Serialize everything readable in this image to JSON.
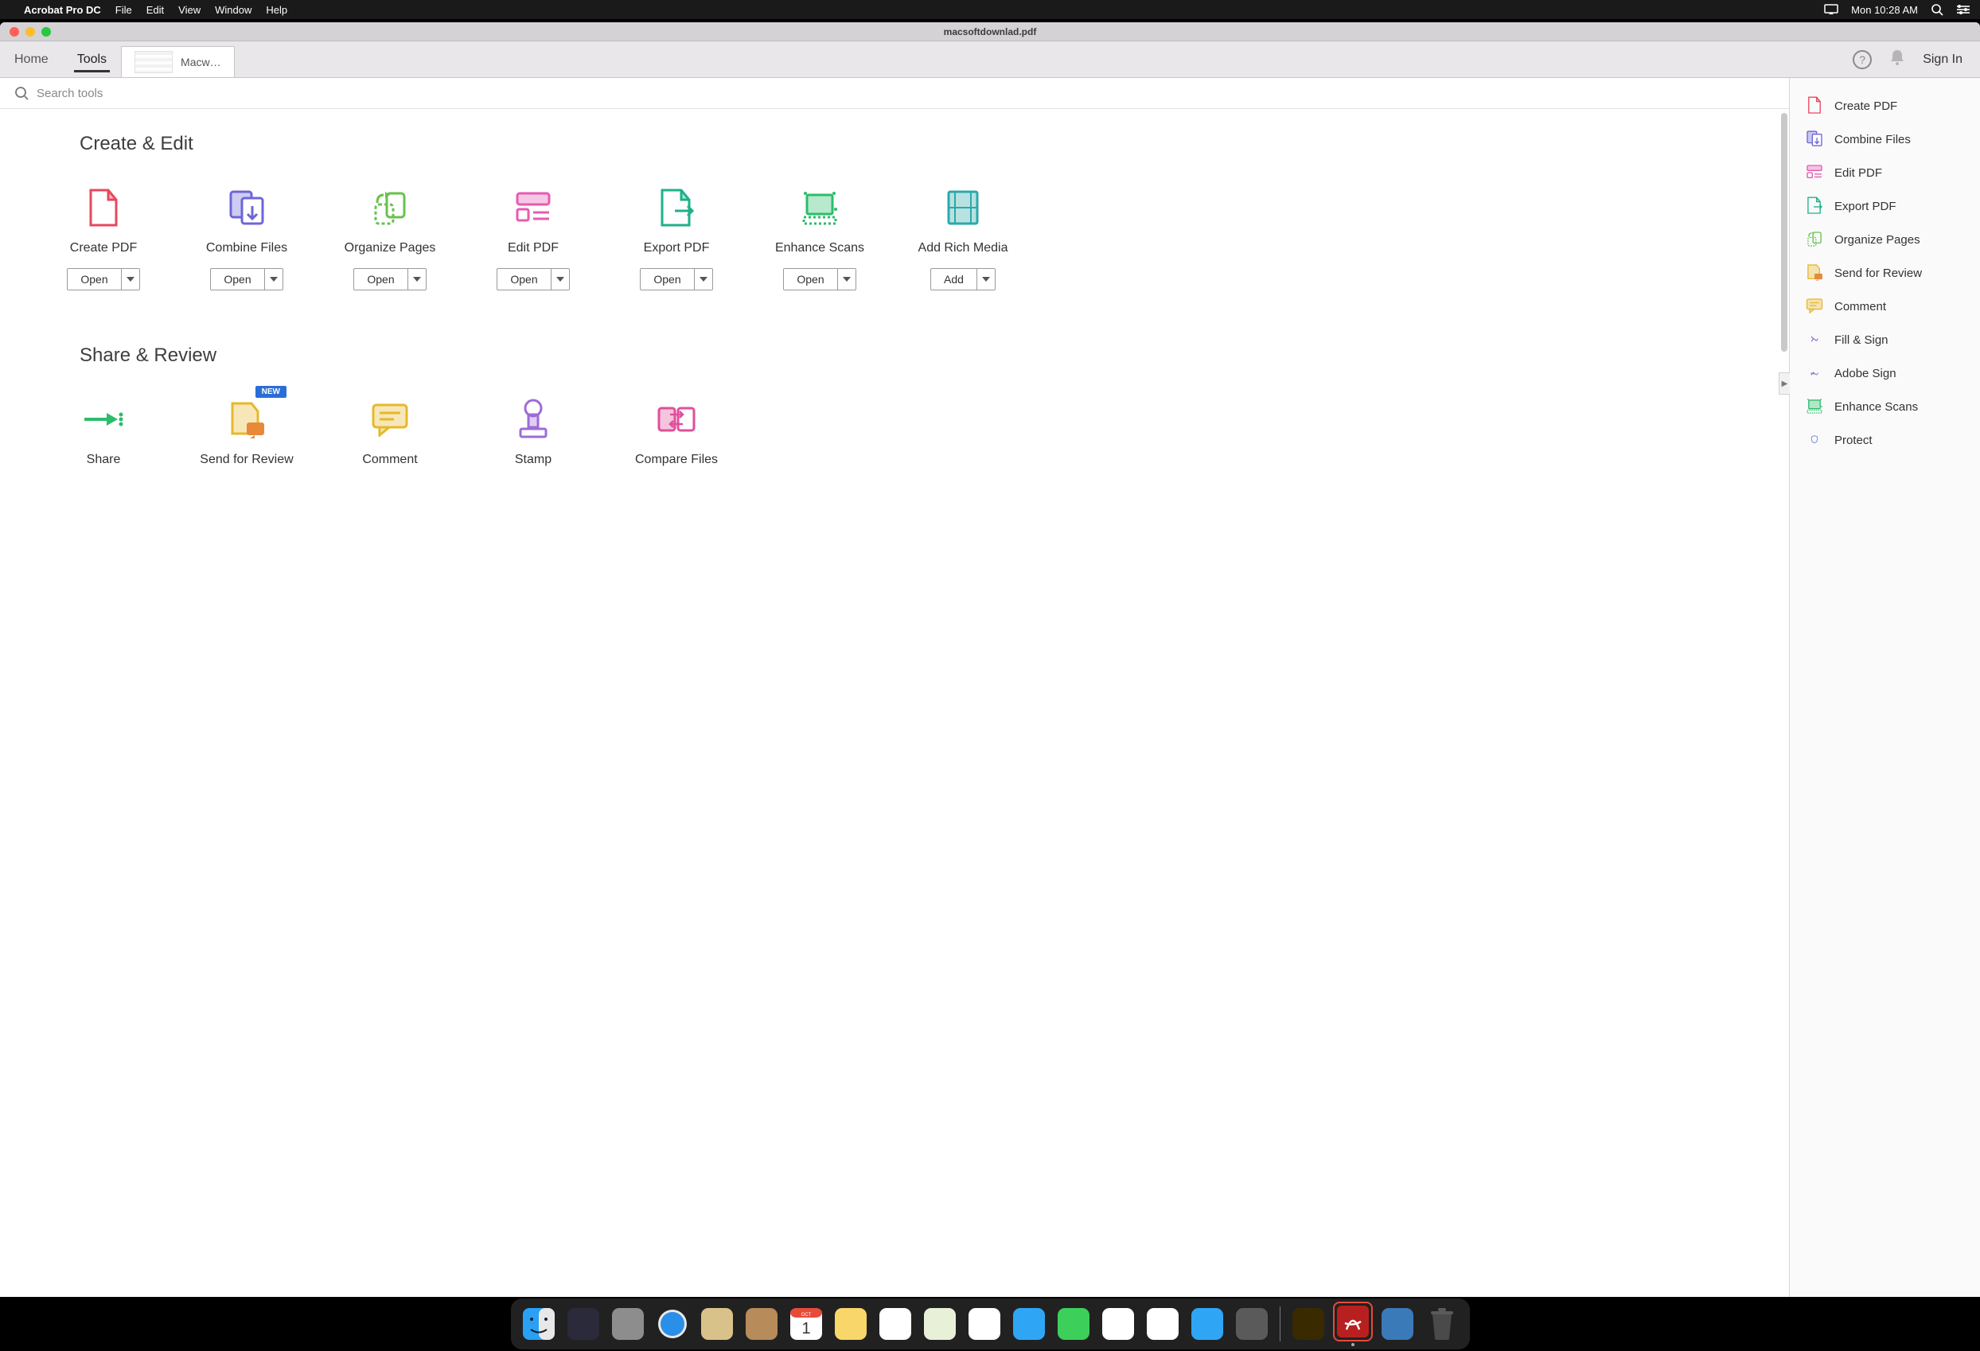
{
  "menubar": {
    "app": "Acrobat Pro DC",
    "items": [
      "File",
      "Edit",
      "View",
      "Window",
      "Help"
    ],
    "clock": "Mon 10:28 AM"
  },
  "window": {
    "title": "macsoftdownlad.pdf"
  },
  "tabs": {
    "home": "Home",
    "tools": "Tools",
    "doc": "Macw…"
  },
  "topright": {
    "signin": "Sign In"
  },
  "search": {
    "placeholder": "Search tools"
  },
  "sections": [
    {
      "title": "Create & Edit",
      "tools": [
        {
          "label": "Create PDF",
          "btn": "Open",
          "icon": "create-pdf",
          "color": "#e8475f"
        },
        {
          "label": "Combine Files",
          "btn": "Open",
          "icon": "combine",
          "color": "#6c66d8"
        },
        {
          "label": "Organize Pages",
          "btn": "Open",
          "icon": "organize",
          "color": "#67c24e"
        },
        {
          "label": "Edit PDF",
          "btn": "Open",
          "icon": "edit-pdf",
          "color": "#e65bb2"
        },
        {
          "label": "Export PDF",
          "btn": "Open",
          "icon": "export",
          "color": "#1fb18a"
        },
        {
          "label": "Enhance Scans",
          "btn": "Open",
          "icon": "enhance",
          "color": "#2bbd6a"
        },
        {
          "label": "Add Rich Media",
          "btn": "Add",
          "icon": "rich-media",
          "color": "#2aa9a9"
        }
      ]
    },
    {
      "title": "Share & Review",
      "tools": [
        {
          "label": "Share",
          "btn": "",
          "icon": "share",
          "color": "#2bbd6a"
        },
        {
          "label": "Send for Review",
          "btn": "",
          "icon": "send-review",
          "color": "#e6b82b",
          "badge": "NEW"
        },
        {
          "label": "Comment",
          "btn": "",
          "icon": "comment",
          "color": "#e6b82b"
        },
        {
          "label": "Stamp",
          "btn": "",
          "icon": "stamp",
          "color": "#9d6cd8"
        },
        {
          "label": "Compare Files",
          "btn": "",
          "icon": "compare",
          "color": "#e04f9a"
        }
      ]
    }
  ],
  "sidebar": [
    {
      "label": "Create PDF",
      "icon": "create-pdf",
      "color": "#e8475f"
    },
    {
      "label": "Combine Files",
      "icon": "combine",
      "color": "#6c66d8"
    },
    {
      "label": "Edit PDF",
      "icon": "edit-pdf",
      "color": "#e65bb2"
    },
    {
      "label": "Export PDF",
      "icon": "export",
      "color": "#1fb18a"
    },
    {
      "label": "Organize Pages",
      "icon": "organize",
      "color": "#67c24e"
    },
    {
      "label": "Send for Review",
      "icon": "send-review",
      "color": "#e6b82b"
    },
    {
      "label": "Comment",
      "icon": "comment",
      "color": "#e6b82b"
    },
    {
      "label": "Fill & Sign",
      "icon": "fill-sign",
      "color": "#8a5fd6"
    },
    {
      "label": "Adobe Sign",
      "icon": "adobe-sign",
      "color": "#8a5fd6"
    },
    {
      "label": "Enhance Scans",
      "icon": "enhance",
      "color": "#2bbd6a"
    },
    {
      "label": "Protect",
      "icon": "protect",
      "color": "#7a8fd6"
    }
  ],
  "dock": [
    {
      "name": "finder",
      "bg": "#2aa0f5"
    },
    {
      "name": "siri",
      "bg": "#2a2a3a"
    },
    {
      "name": "launchpad",
      "bg": "#8d8d8d"
    },
    {
      "name": "safari",
      "bg": "#e8e8e8"
    },
    {
      "name": "mail",
      "bg": "#d9c28a"
    },
    {
      "name": "contacts",
      "bg": "#b88b5a"
    },
    {
      "name": "calendar",
      "bg": "#ffffff"
    },
    {
      "name": "notes",
      "bg": "#f9d66a"
    },
    {
      "name": "reminders",
      "bg": "#ffffff"
    },
    {
      "name": "maps",
      "bg": "#e8f0d8"
    },
    {
      "name": "photos",
      "bg": "#ffffff"
    },
    {
      "name": "messages",
      "bg": "#2fa6f5"
    },
    {
      "name": "facetime",
      "bg": "#3cd05a"
    },
    {
      "name": "news",
      "bg": "#ffffff"
    },
    {
      "name": "itunes",
      "bg": "#ffffff"
    },
    {
      "name": "appstore",
      "bg": "#2fa6f5"
    },
    {
      "name": "preferences",
      "bg": "#5a5a5a"
    }
  ],
  "dock2": [
    {
      "name": "illustrator",
      "bg": "#3a2a00"
    },
    {
      "name": "acrobat",
      "bg": "#b82020",
      "active": true
    },
    {
      "name": "downloads",
      "bg": "#3a7ab8"
    },
    {
      "name": "trash",
      "bg": "#3a3a3a"
    }
  ]
}
